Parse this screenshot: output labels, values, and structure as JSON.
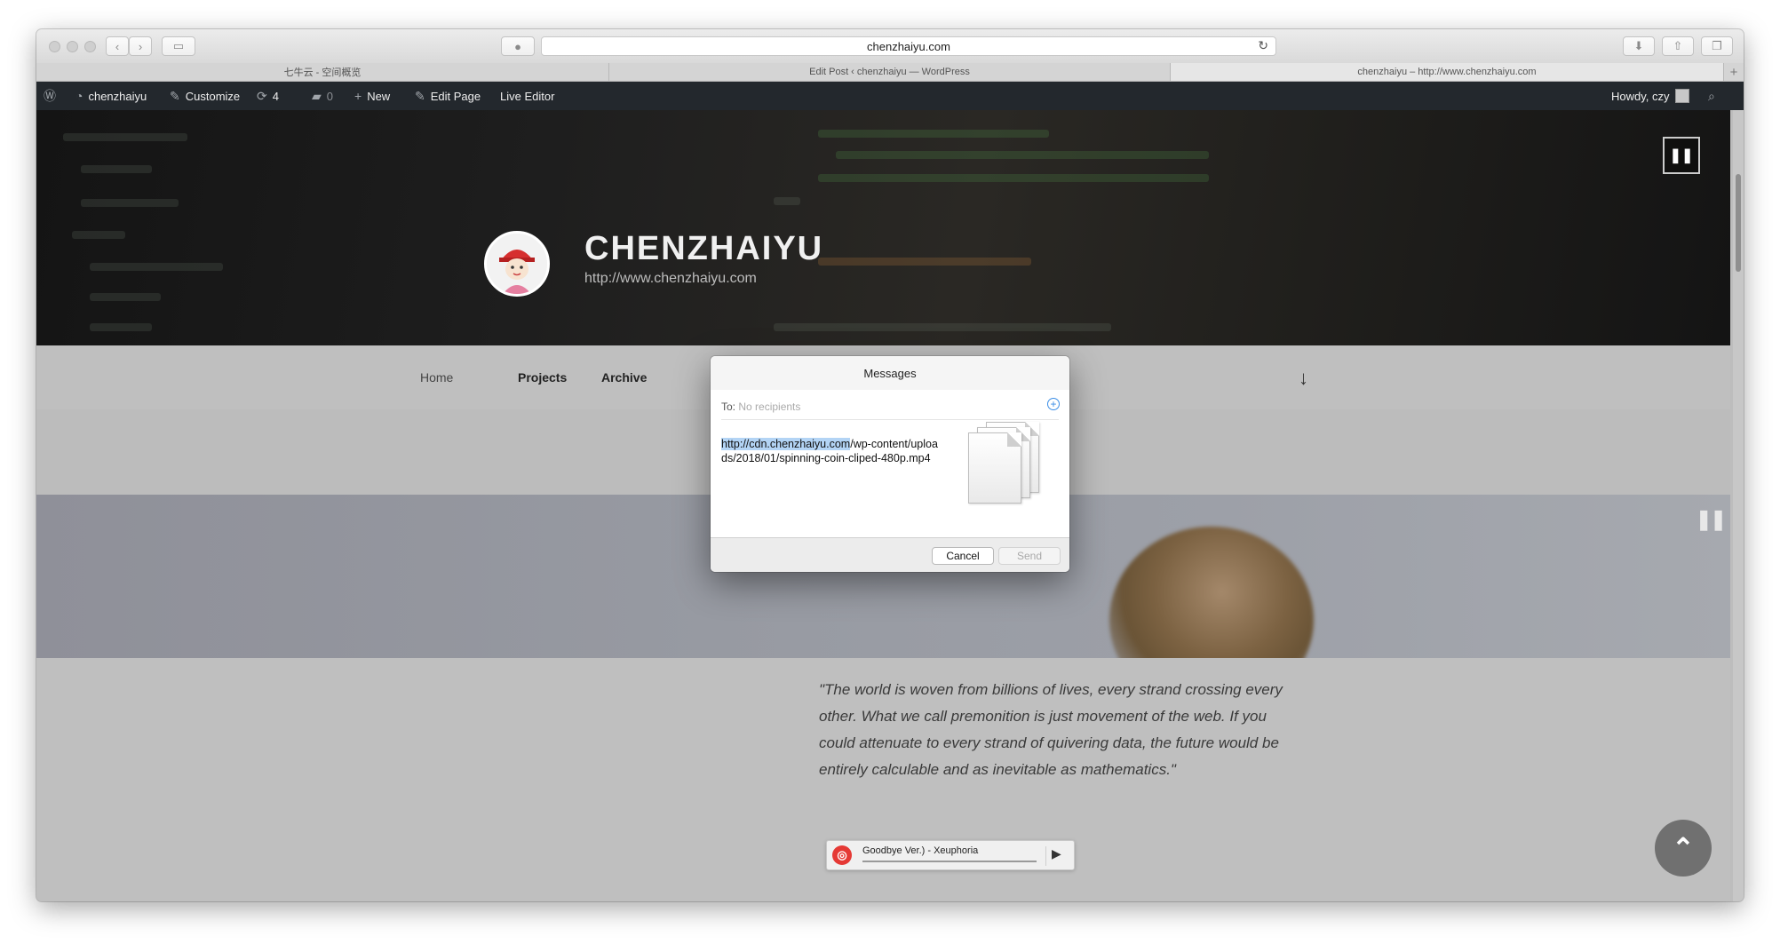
{
  "browser": {
    "url": "chenzhaiyu.com",
    "tabs": [
      {
        "label": "七牛云 - 空间概览",
        "active": false
      },
      {
        "label": "Edit Post ‹ chenzhaiyu — WordPress",
        "active": false
      },
      {
        "label": "chenzhaiyu – http://www.chenzhaiyu.com",
        "active": true
      }
    ]
  },
  "adminbar": {
    "site_name": "chenzhaiyu",
    "customize": "Customize",
    "updates_count": "4",
    "comments_count": "0",
    "new": "New",
    "edit_page": "Edit Page",
    "live_editor": "Live Editor",
    "howdy": "Howdy, czy"
  },
  "hero": {
    "title": "CHENZHAIYU",
    "url": "http://www.chenzhaiyu.com"
  },
  "nav": {
    "items": [
      "Home",
      "Projects",
      "Archive"
    ]
  },
  "quote": "\"The world is woven from billions of lives, every strand crossing every other. What we call premonition is just movement of the web. If you could attenuate to every strand of quivering data, the future would be entirely calculable and as inevitable as mathematics.\"",
  "player": {
    "track": "Goodbye Ver.) - Xeuphoria"
  },
  "dialog": {
    "title": "Messages",
    "to_label": "To:",
    "to_placeholder": "No recipients",
    "message_highlight": "http://cdn.chenzhaiyu.com",
    "message_rest": "/wp-content/uploads/2018/01/spinning-coin-cliped-480p.mp4",
    "cancel": "Cancel",
    "send": "Send"
  },
  "colors": {
    "adminbar_bg": "#23282d",
    "highlight": "#b3d4f5",
    "accent_blue": "#3b8ee6"
  }
}
